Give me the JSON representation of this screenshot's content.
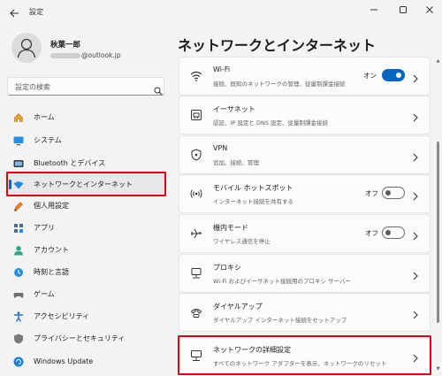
{
  "window": {
    "title": "設定",
    "back_icon": "arrow-left-icon",
    "minimize_icon": "minimize-icon",
    "maximize_icon": "maximize-icon",
    "close_icon": "close-icon"
  },
  "user": {
    "name": "秋葉一郎",
    "email_suffix": "@outlook.jp",
    "avatar_icon": "person-icon"
  },
  "search": {
    "placeholder": "設定の検索",
    "icon": "search-icon"
  },
  "sidebar": {
    "items": [
      {
        "label": "ホーム",
        "icon": "home-icon",
        "active": false
      },
      {
        "label": "システム",
        "icon": "monitor-icon",
        "active": false
      },
      {
        "label": "Bluetooth とデバイス",
        "icon": "bluetooth-icon",
        "active": false
      },
      {
        "label": "ネットワークとインターネット",
        "icon": "wifi-icon",
        "active": true
      },
      {
        "label": "個人用設定",
        "icon": "brush-icon",
        "active": false
      },
      {
        "label": "アプリ",
        "icon": "apps-icon",
        "active": false
      },
      {
        "label": "アカウント",
        "icon": "account-icon",
        "active": false
      },
      {
        "label": "時刻と言語",
        "icon": "globe-clock-icon",
        "active": false
      },
      {
        "label": "ゲーム",
        "icon": "gamepad-icon",
        "active": false
      },
      {
        "label": "アクセシビリティ",
        "icon": "accessibility-icon",
        "active": false
      },
      {
        "label": "プライバシーとセキュリティ",
        "icon": "shield-icon",
        "active": false
      },
      {
        "label": "Windows Update",
        "icon": "update-icon",
        "active": false
      }
    ]
  },
  "main": {
    "title": "ネットワークとインターネット",
    "cards": [
      {
        "title": "Wi-Fi",
        "desc": "接続、既知のネットワークの管理、従量制課金接続",
        "icon": "wifi-icon",
        "toggle": "on",
        "toggle_label": "オン"
      },
      {
        "title": "イーサネット",
        "desc": "認証、IP 設定と DNS 設定、従量制課金接続",
        "icon": "ethernet-icon"
      },
      {
        "title": "VPN",
        "desc": "追加、接続、管理",
        "icon": "vpn-shield-icon"
      },
      {
        "title": "モバイル ホットスポット",
        "desc": "インターネット接続を共有する",
        "icon": "hotspot-icon",
        "toggle": "off",
        "toggle_label": "オフ"
      },
      {
        "title": "機内モード",
        "desc": "ワイヤレス通信を停止",
        "icon": "airplane-icon",
        "toggle": "off",
        "toggle_label": "オフ"
      },
      {
        "title": "プロキシ",
        "desc": "Wi-Fi およびイーサネット接続用のプロキシ サーバー",
        "icon": "proxy-icon"
      },
      {
        "title": "ダイヤルアップ",
        "desc": "ダイヤルアップ インターネット接続をセットアップ",
        "icon": "dialup-icon"
      },
      {
        "title": "ネットワークの詳細設定",
        "desc": "すべてのネットワーク アダプターを表示、ネットワークのリセット",
        "icon": "network-pc-icon"
      }
    ]
  },
  "colors": {
    "accent": "#0067c0",
    "highlight": "#e0000f",
    "background": "#f3f3f3",
    "card": "#fbfbfb"
  }
}
